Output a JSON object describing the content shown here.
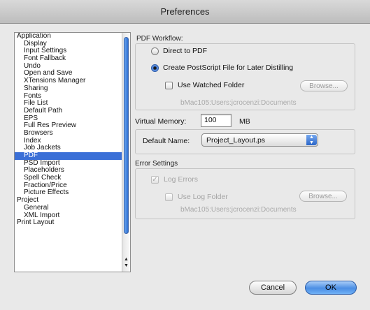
{
  "window": {
    "title": "Preferences"
  },
  "sidebar": {
    "items": [
      {
        "label": "Application",
        "group": true
      },
      {
        "label": "Display"
      },
      {
        "label": "Input Settings"
      },
      {
        "label": "Font Fallback"
      },
      {
        "label": "Undo"
      },
      {
        "label": "Open and Save"
      },
      {
        "label": "XTensions Manager"
      },
      {
        "label": "Sharing"
      },
      {
        "label": "Fonts"
      },
      {
        "label": "File List"
      },
      {
        "label": "Default Path"
      },
      {
        "label": "EPS"
      },
      {
        "label": "Full Res Preview"
      },
      {
        "label": "Browsers"
      },
      {
        "label": "Index"
      },
      {
        "label": "Job Jackets"
      },
      {
        "label": "PDF",
        "selected": true
      },
      {
        "label": "PSD Import"
      },
      {
        "label": "Placeholders"
      },
      {
        "label": "Spell Check"
      },
      {
        "label": "Fraction/Price"
      },
      {
        "label": "Picture Effects"
      },
      {
        "label": "Project",
        "group": true
      },
      {
        "label": "General"
      },
      {
        "label": "XML Import"
      },
      {
        "label": "Print Layout",
        "group": true
      }
    ],
    "scroll_up_arrow": "▲",
    "scroll_down_arrow": "▼"
  },
  "pdf_workflow": {
    "label": "PDF Workflow:",
    "direct_to_pdf": "Direct to PDF",
    "create_postscript": "Create PostScript File for Later Distilling",
    "use_watched_folder": "Use Watched Folder",
    "browse_label": "Browse...",
    "watched_folder_path": "bMac105:Users:jcrocenzi:Documents"
  },
  "virtual_memory": {
    "label": "Virtual Memory:",
    "value": "100",
    "unit": "MB"
  },
  "default_name": {
    "label": "Default Name:",
    "value": "Project_Layout.ps",
    "arrow_up": "▲",
    "arrow_down": "▼"
  },
  "error_settings": {
    "label": "Error Settings",
    "log_errors": "Log Errors",
    "log_errors_check": "✓",
    "use_log_folder": "Use Log Folder",
    "browse_label": "Browse...",
    "log_folder_path": "bMac105:Users:jcrocenzi:Documents"
  },
  "buttons": {
    "cancel": "Cancel",
    "ok": "OK"
  }
}
